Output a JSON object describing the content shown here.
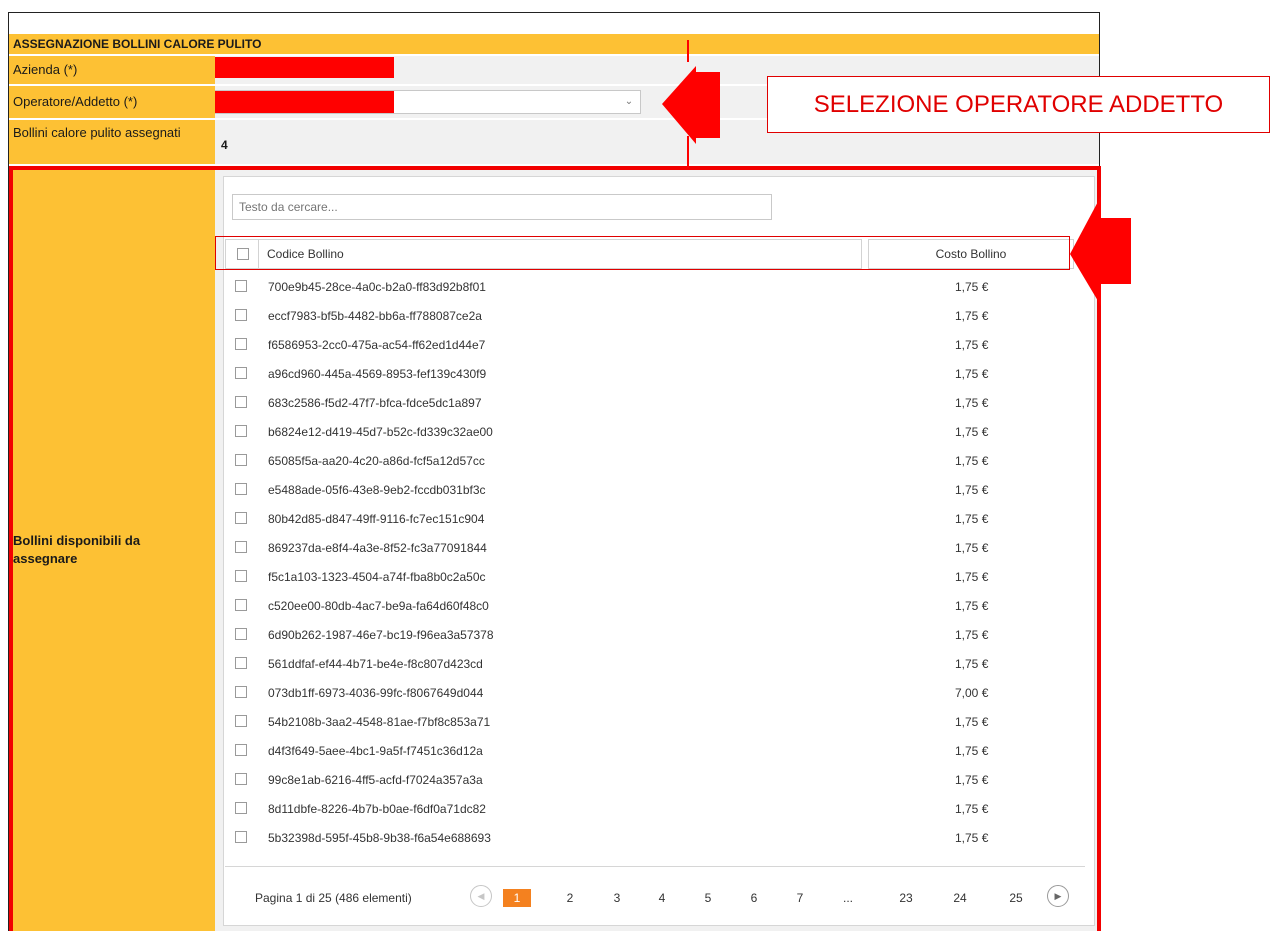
{
  "form": {
    "title": "ASSEGNAZIONE BOLLINI CALORE PULITO",
    "azienda_label": "Azienda (*)",
    "operatore_label": "Operatore/Addetto (*)",
    "assegnati_label": "Bollini calore pulito assegnati",
    "assegnati_value": "4",
    "disponibili_label": "Bollini disponibili da assegnare"
  },
  "callout": {
    "text": "SELEZIONE OPERATORE ADDETTO",
    "color": "#e00000"
  },
  "grid": {
    "search_placeholder": "Testo da cercare...",
    "col_code": "Codice Bollino",
    "col_cost": "Costo Bollino",
    "rows": [
      {
        "code": "700e9b45-28ce-4a0c-b2a0-ff83d92b8f01",
        "cost": "1,75 €"
      },
      {
        "code": "eccf7983-bf5b-4482-bb6a-ff788087ce2a",
        "cost": "1,75 €"
      },
      {
        "code": "f6586953-2cc0-475a-ac54-ff62ed1d44e7",
        "cost": "1,75 €"
      },
      {
        "code": "a96cd960-445a-4569-8953-fef139c430f9",
        "cost": "1,75 €"
      },
      {
        "code": "683c2586-f5d2-47f7-bfca-fdce5dc1a897",
        "cost": "1,75 €"
      },
      {
        "code": "b6824e12-d419-45d7-b52c-fd339c32ae00",
        "cost": "1,75 €"
      },
      {
        "code": "65085f5a-aa20-4c20-a86d-fcf5a12d57cc",
        "cost": "1,75 €"
      },
      {
        "code": "e5488ade-05f6-43e8-9eb2-fccdb031bf3c",
        "cost": "1,75 €"
      },
      {
        "code": "80b42d85-d847-49ff-9116-fc7ec151c904",
        "cost": "1,75 €"
      },
      {
        "code": "869237da-e8f4-4a3e-8f52-fc3a77091844",
        "cost": "1,75 €"
      },
      {
        "code": "f5c1a103-1323-4504-a74f-fba8b0c2a50c",
        "cost": "1,75 €"
      },
      {
        "code": "c520ee00-80db-4ac7-be9a-fa64d60f48c0",
        "cost": "1,75 €"
      },
      {
        "code": "6d90b262-1987-46e7-bc19-f96ea3a57378",
        "cost": "1,75 €"
      },
      {
        "code": "561ddfaf-ef44-4b71-be4e-f8c807d423cd",
        "cost": "1,75 €"
      },
      {
        "code": "073db1ff-6973-4036-99fc-f8067649d044",
        "cost": "7,00 €"
      },
      {
        "code": "54b2108b-3aa2-4548-81ae-f7bf8c853a71",
        "cost": "1,75 €"
      },
      {
        "code": "d4f3f649-5aee-4bc1-9a5f-f7451c36d12a",
        "cost": "1,75 €"
      },
      {
        "code": "99c8e1ab-6216-4ff5-acfd-f7024a357a3a",
        "cost": "1,75 €"
      },
      {
        "code": "8d11dbfe-8226-4b7b-b0ae-f6df0a71dc82",
        "cost": "1,75 €"
      },
      {
        "code": "5b32398d-595f-45b8-9b38-f6a54e688693",
        "cost": "1,75 €"
      }
    ]
  },
  "pager": {
    "summary": "Pagina 1 di 25 (486 elementi)",
    "current": "1",
    "pages": [
      "2",
      "3",
      "4",
      "5",
      "6",
      "7",
      "...",
      "23",
      "24",
      "25"
    ],
    "active_color": "#f4811f"
  },
  "colors": {
    "label_bg": "#fdc134",
    "redaction": "#ff0000",
    "annotation": "#f20000"
  }
}
